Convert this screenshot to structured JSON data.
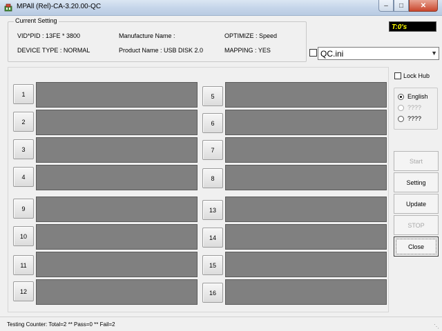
{
  "window": {
    "title": "MPAll (Rel)-CA-3.20.00-QC"
  },
  "current_setting": {
    "label": "Current Setting",
    "vid_pid": "VID*PID : 13FE * 3800",
    "manufacture_name": "Manufacture Name :",
    "optimize": "OPTIMIZE : Speed",
    "device_type": "DEVICE TYPE : NORMAL",
    "product_name": "Product Name : USB DISK 2.0",
    "mapping": "MAPPING : YES"
  },
  "timer": "T:0's",
  "ini": {
    "checked": false,
    "value": "QC.ini"
  },
  "ports": [
    {
      "num": "1"
    },
    {
      "num": "2"
    },
    {
      "num": "3"
    },
    {
      "num": "4"
    },
    {
      "num": "9"
    },
    {
      "num": "10"
    },
    {
      "num": "11"
    },
    {
      "num": "12"
    },
    {
      "num": "5"
    },
    {
      "num": "6"
    },
    {
      "num": "7"
    },
    {
      "num": "8"
    },
    {
      "num": "13"
    },
    {
      "num": "14"
    },
    {
      "num": "15"
    },
    {
      "num": "16"
    }
  ],
  "lock_hub": {
    "label": "Lock Hub",
    "checked": false
  },
  "language": {
    "options": [
      {
        "label": "English",
        "selected": true,
        "enabled": true
      },
      {
        "label": "????",
        "selected": false,
        "enabled": false
      },
      {
        "label": "????",
        "selected": false,
        "enabled": true
      }
    ]
  },
  "actions": {
    "start": "Start",
    "setting": "Setting",
    "update": "Update",
    "stop": "STOP",
    "close": "Close"
  },
  "status": {
    "text": "Testing Counter: Total=2 ** Pass=0 ** Fail=2"
  },
  "colors": {
    "port_bar": "#808080",
    "timer_bg": "#000000",
    "timer_fg": "#ffff00"
  }
}
